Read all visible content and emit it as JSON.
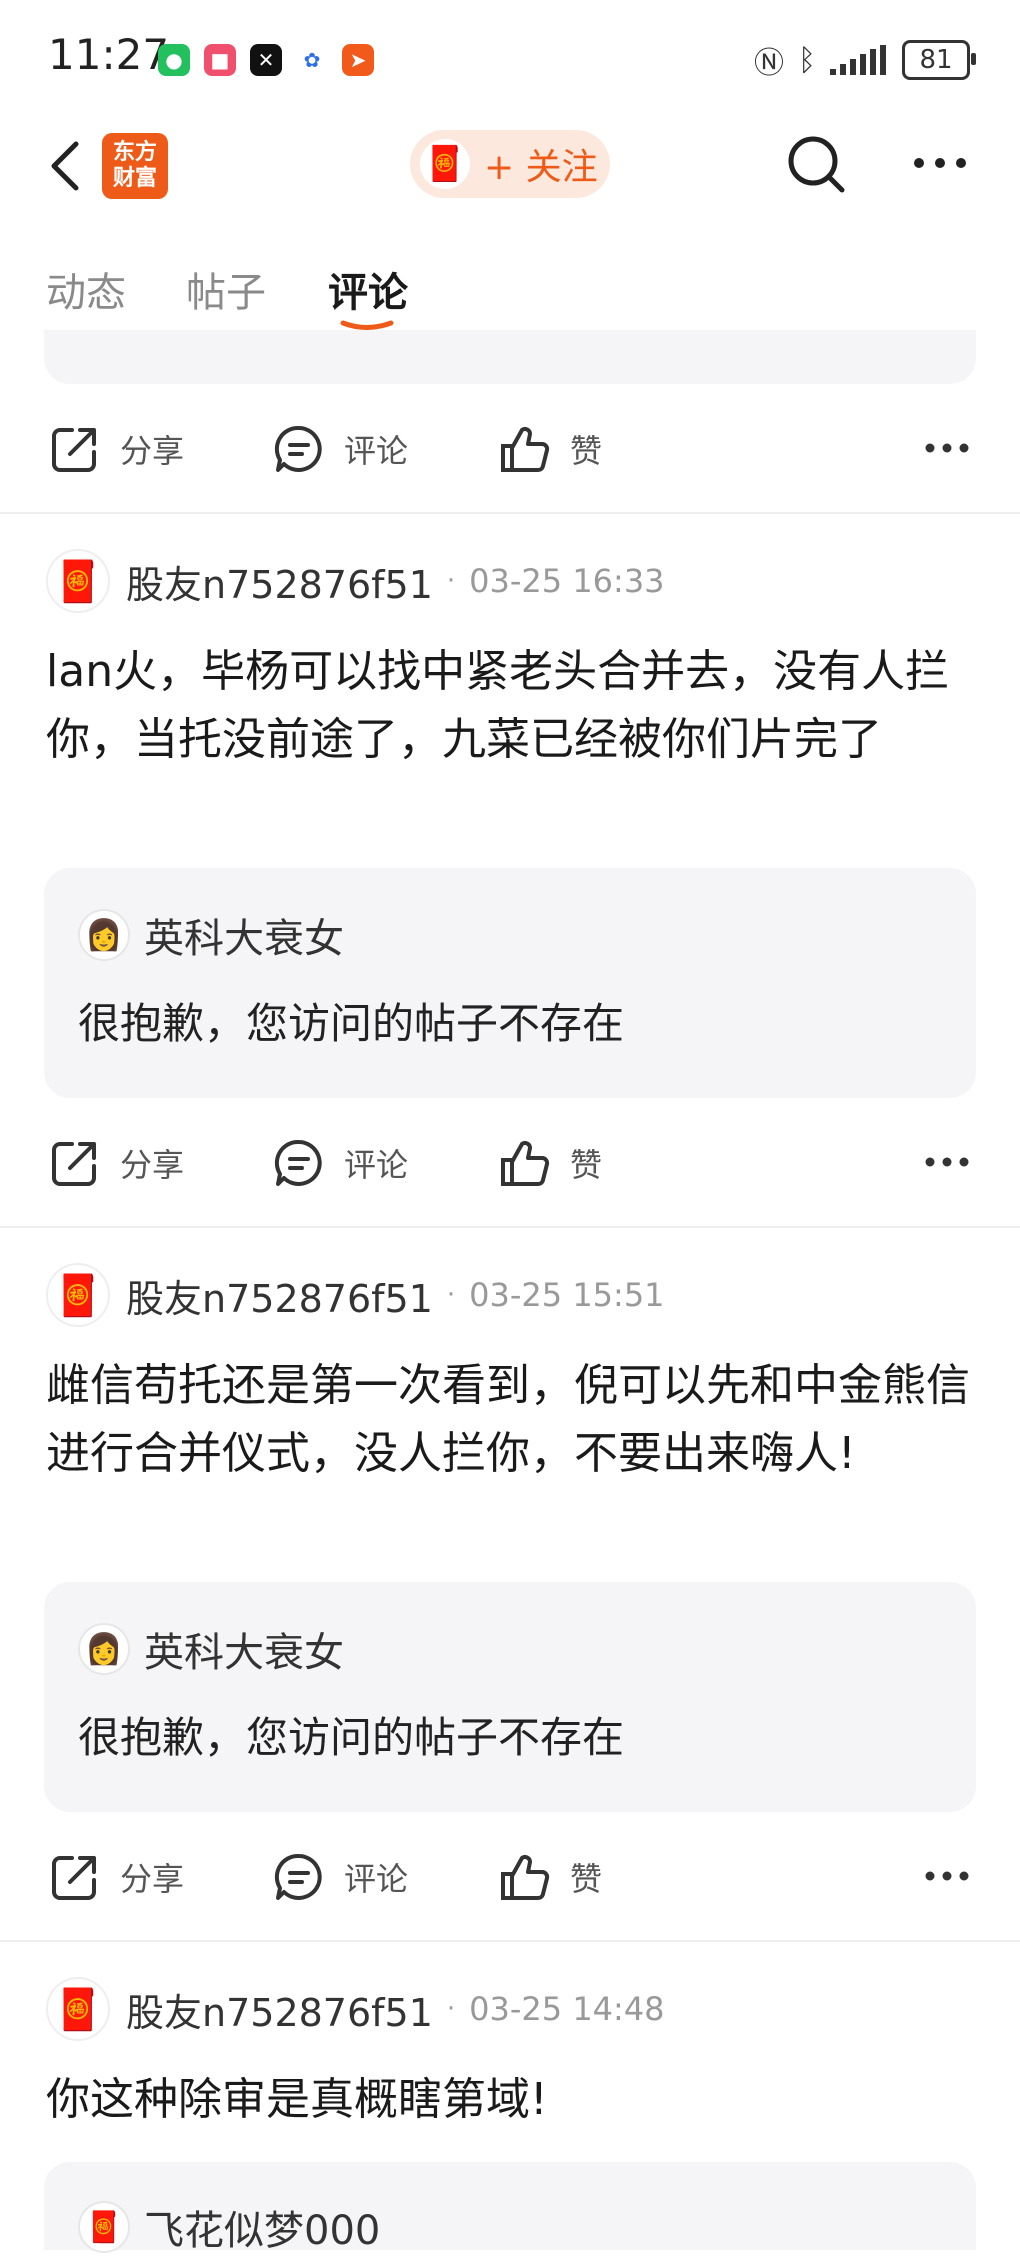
{
  "status_bar": {
    "time": "11:27",
    "battery": "81"
  },
  "header": {
    "logo_line1": "东方",
    "logo_line2": "财富",
    "follow_label": "+ 关注"
  },
  "tabs": [
    {
      "label": "动态"
    },
    {
      "label": "帖子"
    },
    {
      "label": "评论"
    }
  ],
  "active_tab": "评论",
  "actions": {
    "share": "分享",
    "comment": "评论",
    "like": "赞"
  },
  "posts": [
    {
      "author": "股友n752876f51",
      "dot": "·",
      "time": "03-25 16:33",
      "body": "lan火，毕杨可以找中紧老头合并去，没有人拦你，当托没前途了，九菜已经被你们片完了",
      "quote": {
        "name": "英科大衰女",
        "text": "很抱歉，您访问的帖子不存在"
      }
    },
    {
      "author": "股友n752876f51",
      "dot": "·",
      "time": "03-25 15:51",
      "body": "雌信苟托还是第一次看到，倪可以先和中金熊信进行合并仪式，没人拦你，不要出来嗨人!",
      "quote": {
        "name": "英科大衰女",
        "text": "很抱歉，您访问的帖子不存在"
      }
    },
    {
      "author": "股友n752876f51",
      "dot": "·",
      "time": "03-25 14:48",
      "body": "你这种除审是真概瞎第域!",
      "quote": {
        "name": "飞花似梦000",
        "text": ""
      }
    }
  ],
  "colors": {
    "brand": "#ee5b18",
    "quote_bg": "#f5f5f7",
    "meta": "#999999"
  }
}
